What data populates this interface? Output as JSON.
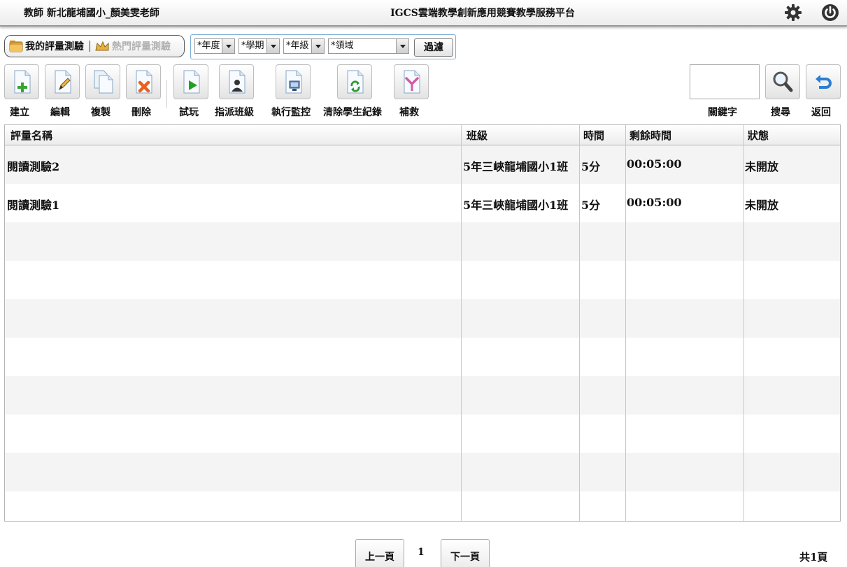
{
  "header": {
    "user_label": "教師 新北龍埔國小_顏美雯老師",
    "platform_title": "IGCS雲端教學創新應用競賽教學服務平台",
    "settings_icon": "gear-icon",
    "logout_icon": "power-icon"
  },
  "tabs": [
    {
      "label": "我的評量測驗",
      "icon": "folder-icon",
      "active": true
    },
    {
      "label": "熱門評量測驗",
      "icon": "crown-icon",
      "active": false
    }
  ],
  "filter": {
    "year": "*年度",
    "semester": "*學期",
    "grade": "*年級",
    "domain": "*領域",
    "button": "過濾"
  },
  "toolbar": {
    "create": "建立",
    "edit": "編輯",
    "copy": "複製",
    "delete": "刪除",
    "preview": "試玩",
    "assign": "指派班級",
    "monitor": "執行監控",
    "clear_records": "清除學生紀錄",
    "remedy": "補救",
    "keyword": "關鍵字",
    "search": "搜尋",
    "back": "返回",
    "keyword_value": ""
  },
  "table": {
    "columns": [
      "評量名稱",
      "班級",
      "時間",
      "剩餘時間",
      "狀態"
    ],
    "rows": [
      {
        "name": "閱讀測驗2",
        "class": "5年三峽龍埔國小1班",
        "time": "5分",
        "remaining": "00:05:00",
        "status": "未開放"
      },
      {
        "name": "閱讀測驗1",
        "class": "5年三峽龍埔國小1班",
        "time": "5分",
        "remaining": "00:05:00",
        "status": "未開放"
      }
    ]
  },
  "pagination": {
    "prev": "上一頁",
    "current": "1",
    "next": "下一頁",
    "total": "共1頁"
  },
  "colors": {
    "accent_green": "#3aa335",
    "delete_orange": "#e8611f",
    "play_green": "#22a022",
    "search_blue": "#2a7fd0",
    "filter_border": "#7fb0d8"
  }
}
